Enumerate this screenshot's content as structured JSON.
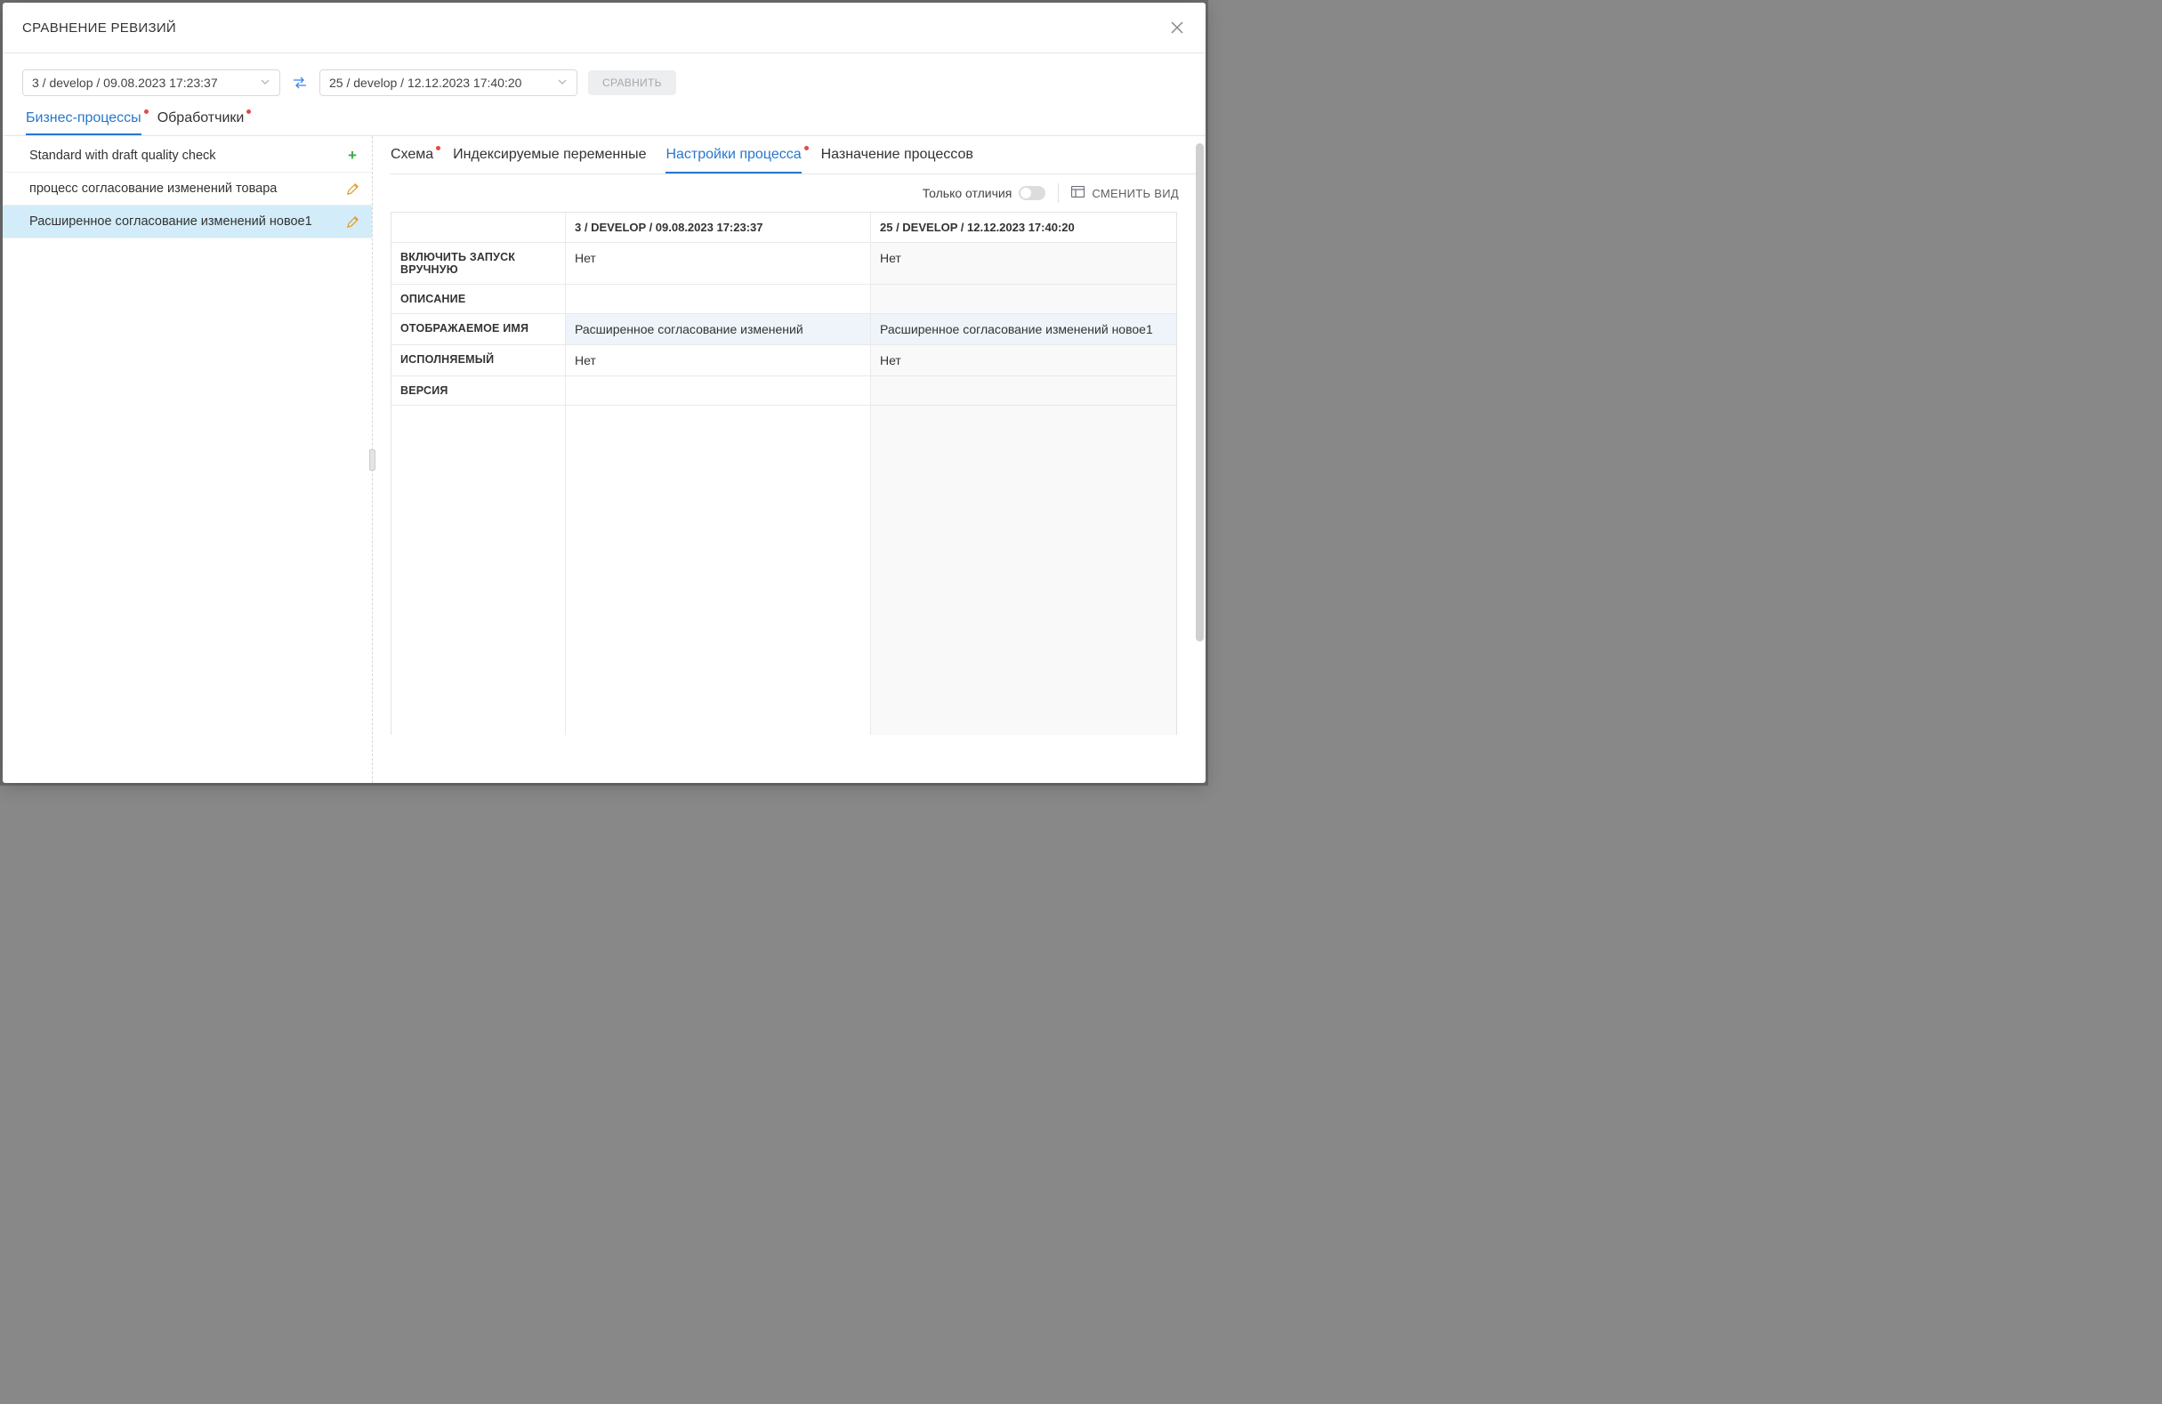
{
  "modal": {
    "title": "СРАВНЕНИЕ РЕВИЗИЙ"
  },
  "controls": {
    "left_select": "3 / develop / 09.08.2023 17:23:37",
    "right_select": "25 / develop / 12.12.2023 17:40:20",
    "compare_label": "СРАВНИТЬ"
  },
  "primary_tabs": {
    "biz": "Бизнес-процессы",
    "handlers": "Обработчики"
  },
  "left_list": {
    "items": [
      {
        "label": "Standard with draft quality check",
        "state": "added"
      },
      {
        "label": "процесс согласование изменений товара",
        "state": "edited"
      },
      {
        "label": "Расширенное согласование изменений новое1",
        "state": "edited"
      }
    ]
  },
  "sub_tabs": {
    "schema": "Схема",
    "indexed": "Индексируемые переменные",
    "settings": "Настройки процесса",
    "assign": "Назначение процессов"
  },
  "toolbar": {
    "diff_only": "Только отличия",
    "change_view": "СМЕНИТЬ ВИД"
  },
  "table": {
    "col1": "3 / DEVELOP / 09.08.2023 17:23:37",
    "col2": "25 / DEVELOP / 12.12.2023 17:40:20",
    "rows": [
      {
        "label": "ВКЛЮЧИТЬ ЗАПУСК ВРУЧНУЮ",
        "v1": "Нет",
        "v2": "Нет",
        "diff": false
      },
      {
        "label": "ОПИСАНИЕ",
        "v1": "",
        "v2": "",
        "diff": false
      },
      {
        "label": "ОТОБРАЖАЕМОЕ ИМЯ",
        "v1": "Расширенное согласование изменений",
        "v2": "Расширенное согласование изменений новое1",
        "diff": true
      },
      {
        "label": "ИСПОЛНЯЕМЫЙ",
        "v1": "Нет",
        "v2": "Нет",
        "diff": false
      },
      {
        "label": "ВЕРСИЯ",
        "v1": "",
        "v2": "",
        "diff": false
      }
    ]
  }
}
